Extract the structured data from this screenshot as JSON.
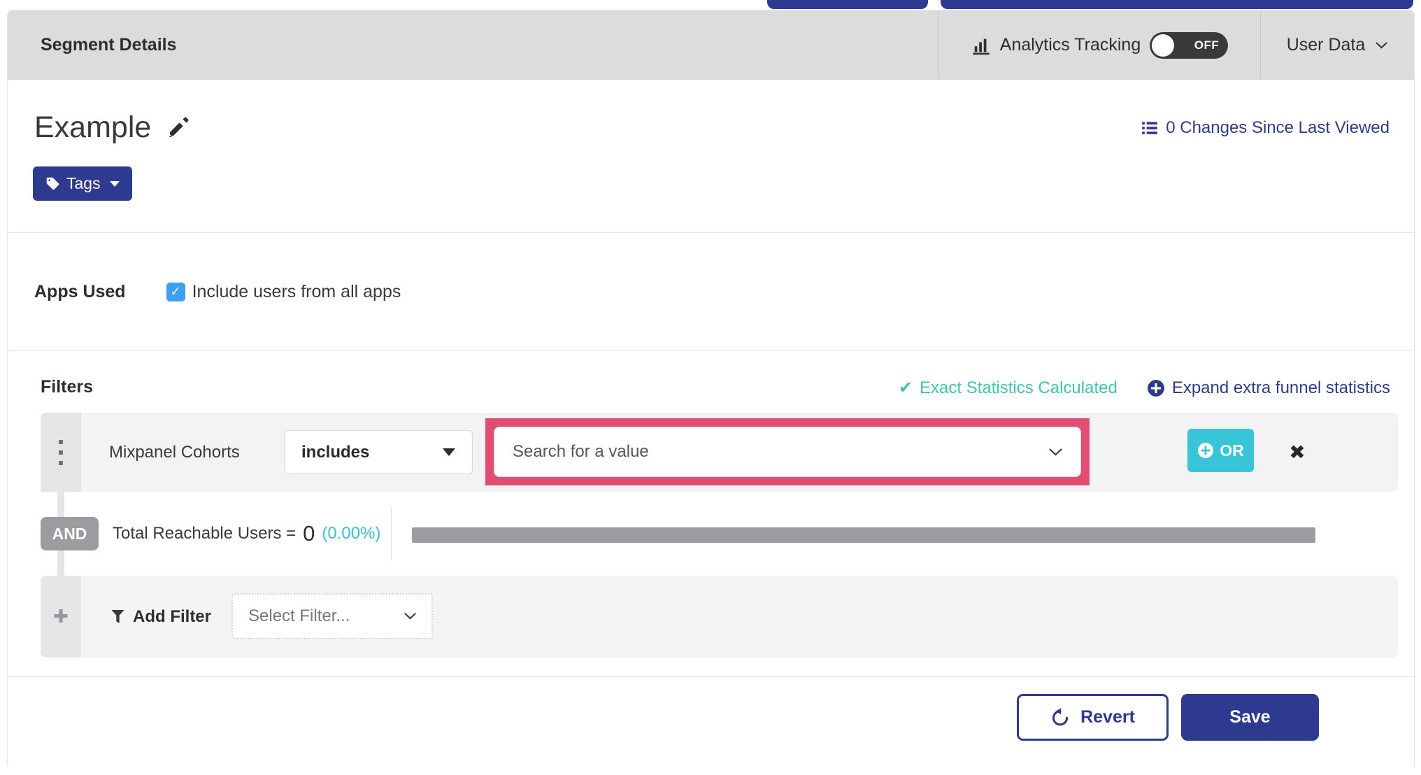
{
  "header": {
    "title": "Segment Details",
    "analytics_label": "Analytics Tracking",
    "toggle_state": "OFF",
    "user_data_label": "User Data"
  },
  "segment": {
    "name": "Example",
    "tags_label": "Tags",
    "changes_link": "0 Changes Since Last Viewed"
  },
  "apps_used": {
    "label": "Apps Used",
    "checkbox_label": "Include users from all apps",
    "checked": true,
    "checkmark": "✓"
  },
  "filters": {
    "heading": "Filters",
    "exact_stats_label": "Exact Statistics Calculated",
    "expand_link_label": "Expand extra funnel statistics",
    "row": {
      "field": "Mixpanel Cohorts",
      "operator": "includes",
      "value_placeholder": "Search for a value",
      "or_label": "OR",
      "remove_glyph": "✖"
    },
    "and_label": "AND",
    "total": {
      "label": "Total Reachable Users =",
      "value": "0",
      "percent": "(0.00%)"
    },
    "add": {
      "plus_glyph": "✚",
      "label": "Add Filter",
      "placeholder": "Select Filter..."
    }
  },
  "footer": {
    "revert_label": "Revert",
    "save_label": "Save"
  },
  "icons": {
    "exact_check": "✔"
  },
  "colors": {
    "navy": "#2d3a8f",
    "header_gray": "#dcdcdf",
    "highlight_pink": "#e14e72",
    "or_teal": "#38c5d8",
    "exact_green": "#3ec7a4",
    "percent_cyan": "#3cc0d2",
    "checkbox_blue": "#3d9ff4",
    "toggle_dark": "#3a3a3c",
    "progress_gray": "#9c9ca0"
  }
}
